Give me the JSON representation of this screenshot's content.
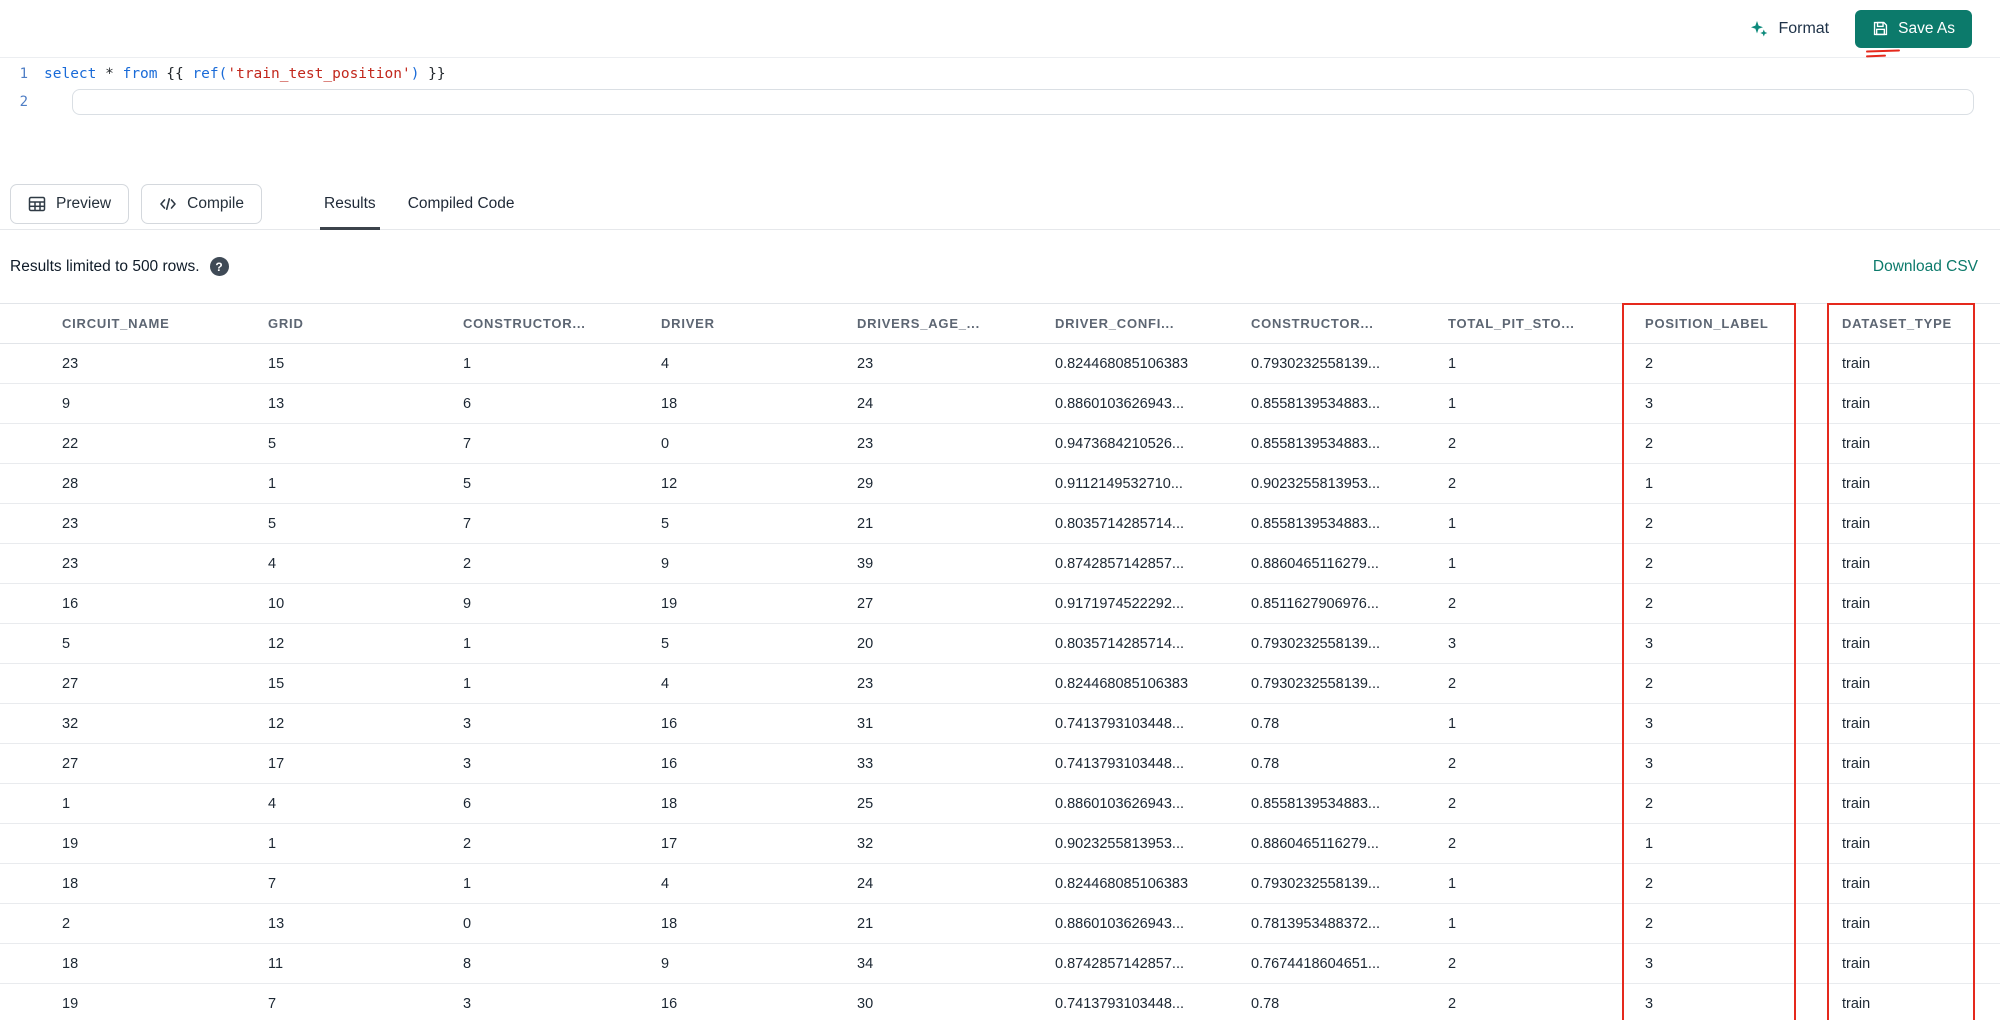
{
  "toolbar": {
    "format_label": "Format",
    "save_as_label": "Save As"
  },
  "editor": {
    "line_numbers": [
      "1",
      "2"
    ],
    "code_parts": [
      {
        "t": "select",
        "c": "kw"
      },
      {
        "t": " * ",
        "c": "pl"
      },
      {
        "t": "from",
        "c": "kw"
      },
      {
        "t": " {{ ",
        "c": "pl"
      },
      {
        "t": "ref(",
        "c": "fn"
      },
      {
        "t": "'train_test_position'",
        "c": "str"
      },
      {
        "t": ")",
        "c": "fn"
      },
      {
        "t": " }}",
        "c": "pl"
      }
    ]
  },
  "actions": {
    "preview_label": "Preview",
    "compile_label": "Compile",
    "tabs": [
      {
        "label": "Results",
        "active": true
      },
      {
        "label": "Compiled Code",
        "active": false
      }
    ]
  },
  "results_meta": {
    "limit_text": "Results limited to 500 rows.",
    "help_icon": "?",
    "download_label": "Download CSV"
  },
  "results_table": {
    "headers": [
      "CIRCUIT_NAME",
      "GRID",
      "CONSTRUCTOR...",
      "DRIVER",
      "DRIVERS_AGE_...",
      "DRIVER_CONFI...",
      "CONSTRUCTOR...",
      "TOTAL_PIT_STO...",
      "POSITION_LABEL",
      "DATASET_TYPE"
    ],
    "rows": [
      [
        "23",
        "15",
        "1",
        "4",
        "23",
        "0.824468085106383",
        "0.7930232558139...",
        "1",
        "2",
        "train"
      ],
      [
        "9",
        "13",
        "6",
        "18",
        "24",
        "0.8860103626943...",
        "0.8558139534883...",
        "1",
        "3",
        "train"
      ],
      [
        "22",
        "5",
        "7",
        "0",
        "23",
        "0.9473684210526...",
        "0.8558139534883...",
        "2",
        "2",
        "train"
      ],
      [
        "28",
        "1",
        "5",
        "12",
        "29",
        "0.9112149532710...",
        "0.9023255813953...",
        "2",
        "1",
        "train"
      ],
      [
        "23",
        "5",
        "7",
        "5",
        "21",
        "0.8035714285714...",
        "0.8558139534883...",
        "1",
        "2",
        "train"
      ],
      [
        "23",
        "4",
        "2",
        "9",
        "39",
        "0.8742857142857...",
        "0.8860465116279...",
        "1",
        "2",
        "train"
      ],
      [
        "16",
        "10",
        "9",
        "19",
        "27",
        "0.9171974522292...",
        "0.8511627906976...",
        "2",
        "2",
        "train"
      ],
      [
        "5",
        "12",
        "1",
        "5",
        "20",
        "0.8035714285714...",
        "0.7930232558139...",
        "3",
        "3",
        "train"
      ],
      [
        "27",
        "15",
        "1",
        "4",
        "23",
        "0.824468085106383",
        "0.7930232558139...",
        "2",
        "2",
        "train"
      ],
      [
        "32",
        "12",
        "3",
        "16",
        "31",
        "0.7413793103448...",
        "0.78",
        "1",
        "3",
        "train"
      ],
      [
        "27",
        "17",
        "3",
        "16",
        "33",
        "0.7413793103448...",
        "0.78",
        "2",
        "3",
        "train"
      ],
      [
        "1",
        "4",
        "6",
        "18",
        "25",
        "0.8860103626943...",
        "0.8558139534883...",
        "2",
        "2",
        "train"
      ],
      [
        "19",
        "1",
        "2",
        "17",
        "32",
        "0.9023255813953...",
        "0.8860465116279...",
        "2",
        "1",
        "train"
      ],
      [
        "18",
        "7",
        "1",
        "4",
        "24",
        "0.824468085106383",
        "0.7930232558139...",
        "1",
        "2",
        "train"
      ],
      [
        "2",
        "13",
        "0",
        "18",
        "21",
        "0.8860103626943...",
        "0.7813953488372...",
        "1",
        "2",
        "train"
      ],
      [
        "18",
        "11",
        "8",
        "9",
        "34",
        "0.8742857142857...",
        "0.7674418604651...",
        "2",
        "3",
        "train"
      ],
      [
        "19",
        "7",
        "3",
        "16",
        "30",
        "0.7413793103448...",
        "0.78",
        "2",
        "3",
        "train"
      ]
    ],
    "highlighted_columns": [
      "POSITION_LABEL",
      "DATASET_TYPE"
    ],
    "highlight_color": "#e5291d"
  }
}
